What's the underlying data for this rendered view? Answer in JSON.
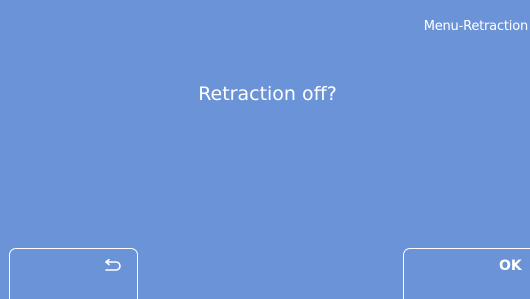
{
  "screen": {
    "menu_title": "Menu-Retraction",
    "question": "Retraction off?"
  },
  "buttons": {
    "back_icon": "return-arrow-icon",
    "ok_label": "OK"
  },
  "colors": {
    "background": "#6a93d8",
    "text": "#ffffff",
    "button_border": "#ffffff"
  }
}
